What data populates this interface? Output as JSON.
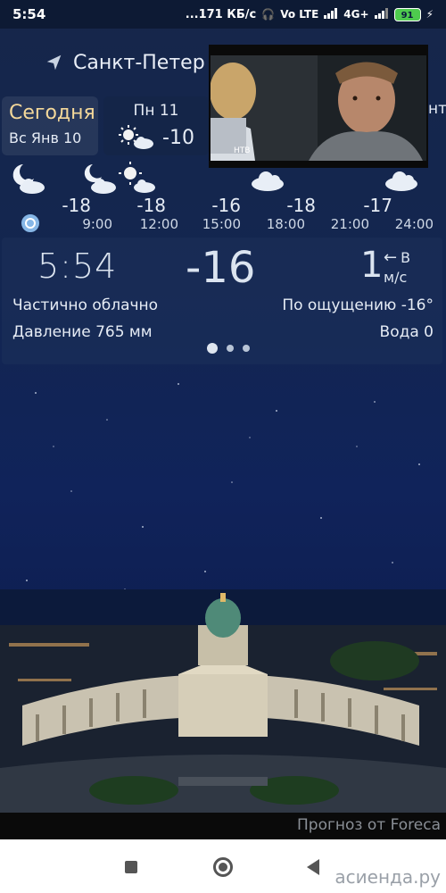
{
  "status_bar": {
    "time": "5:54",
    "network_speed": "...171 КБ/с",
    "network_type": "4G+",
    "volte": "Vo LTE",
    "battery": "91"
  },
  "location": {
    "city": "Санкт-Петер"
  },
  "days": [
    {
      "name": "Сегодня",
      "date": "Вс Янв 10"
    },
    {
      "name": "Пн 11",
      "temp": "-10",
      "icon": "sun-cloud-icon"
    }
  ],
  "partial_day_label": "нт",
  "hourly": [
    {
      "icon": "moon-cloud-icon",
      "temp": "",
      "time": ""
    },
    {
      "icon": "moon-cloud-icon",
      "temp": "-18",
      "time": "9:00"
    },
    {
      "icon": "sun-cloud-icon",
      "temp": "-18",
      "time": "12:00"
    },
    {
      "icon": "",
      "temp": "-16",
      "time": "15:00"
    },
    {
      "icon": "cloud-icon",
      "temp": "-18",
      "time": "18:00"
    },
    {
      "icon": "",
      "temp": "-17",
      "time": "21:00"
    },
    {
      "icon": "cloud-icon",
      "temp": "",
      "time": "24:00"
    }
  ],
  "current": {
    "time": "5:54",
    "temp": "-16",
    "wind_speed": "1",
    "wind_dir": "В",
    "wind_unit": "м/с",
    "condition": "Частично облачно",
    "feels_like": "По ощущению -16°",
    "pressure": "Давление 765 мм",
    "water": "Вода 0",
    "pager_active_index": 0
  },
  "footer": {
    "attribution": "Прогноз от Foreca",
    "watermark": "асиенда.ру"
  },
  "video": {
    "channel_logo": "НТВ"
  }
}
